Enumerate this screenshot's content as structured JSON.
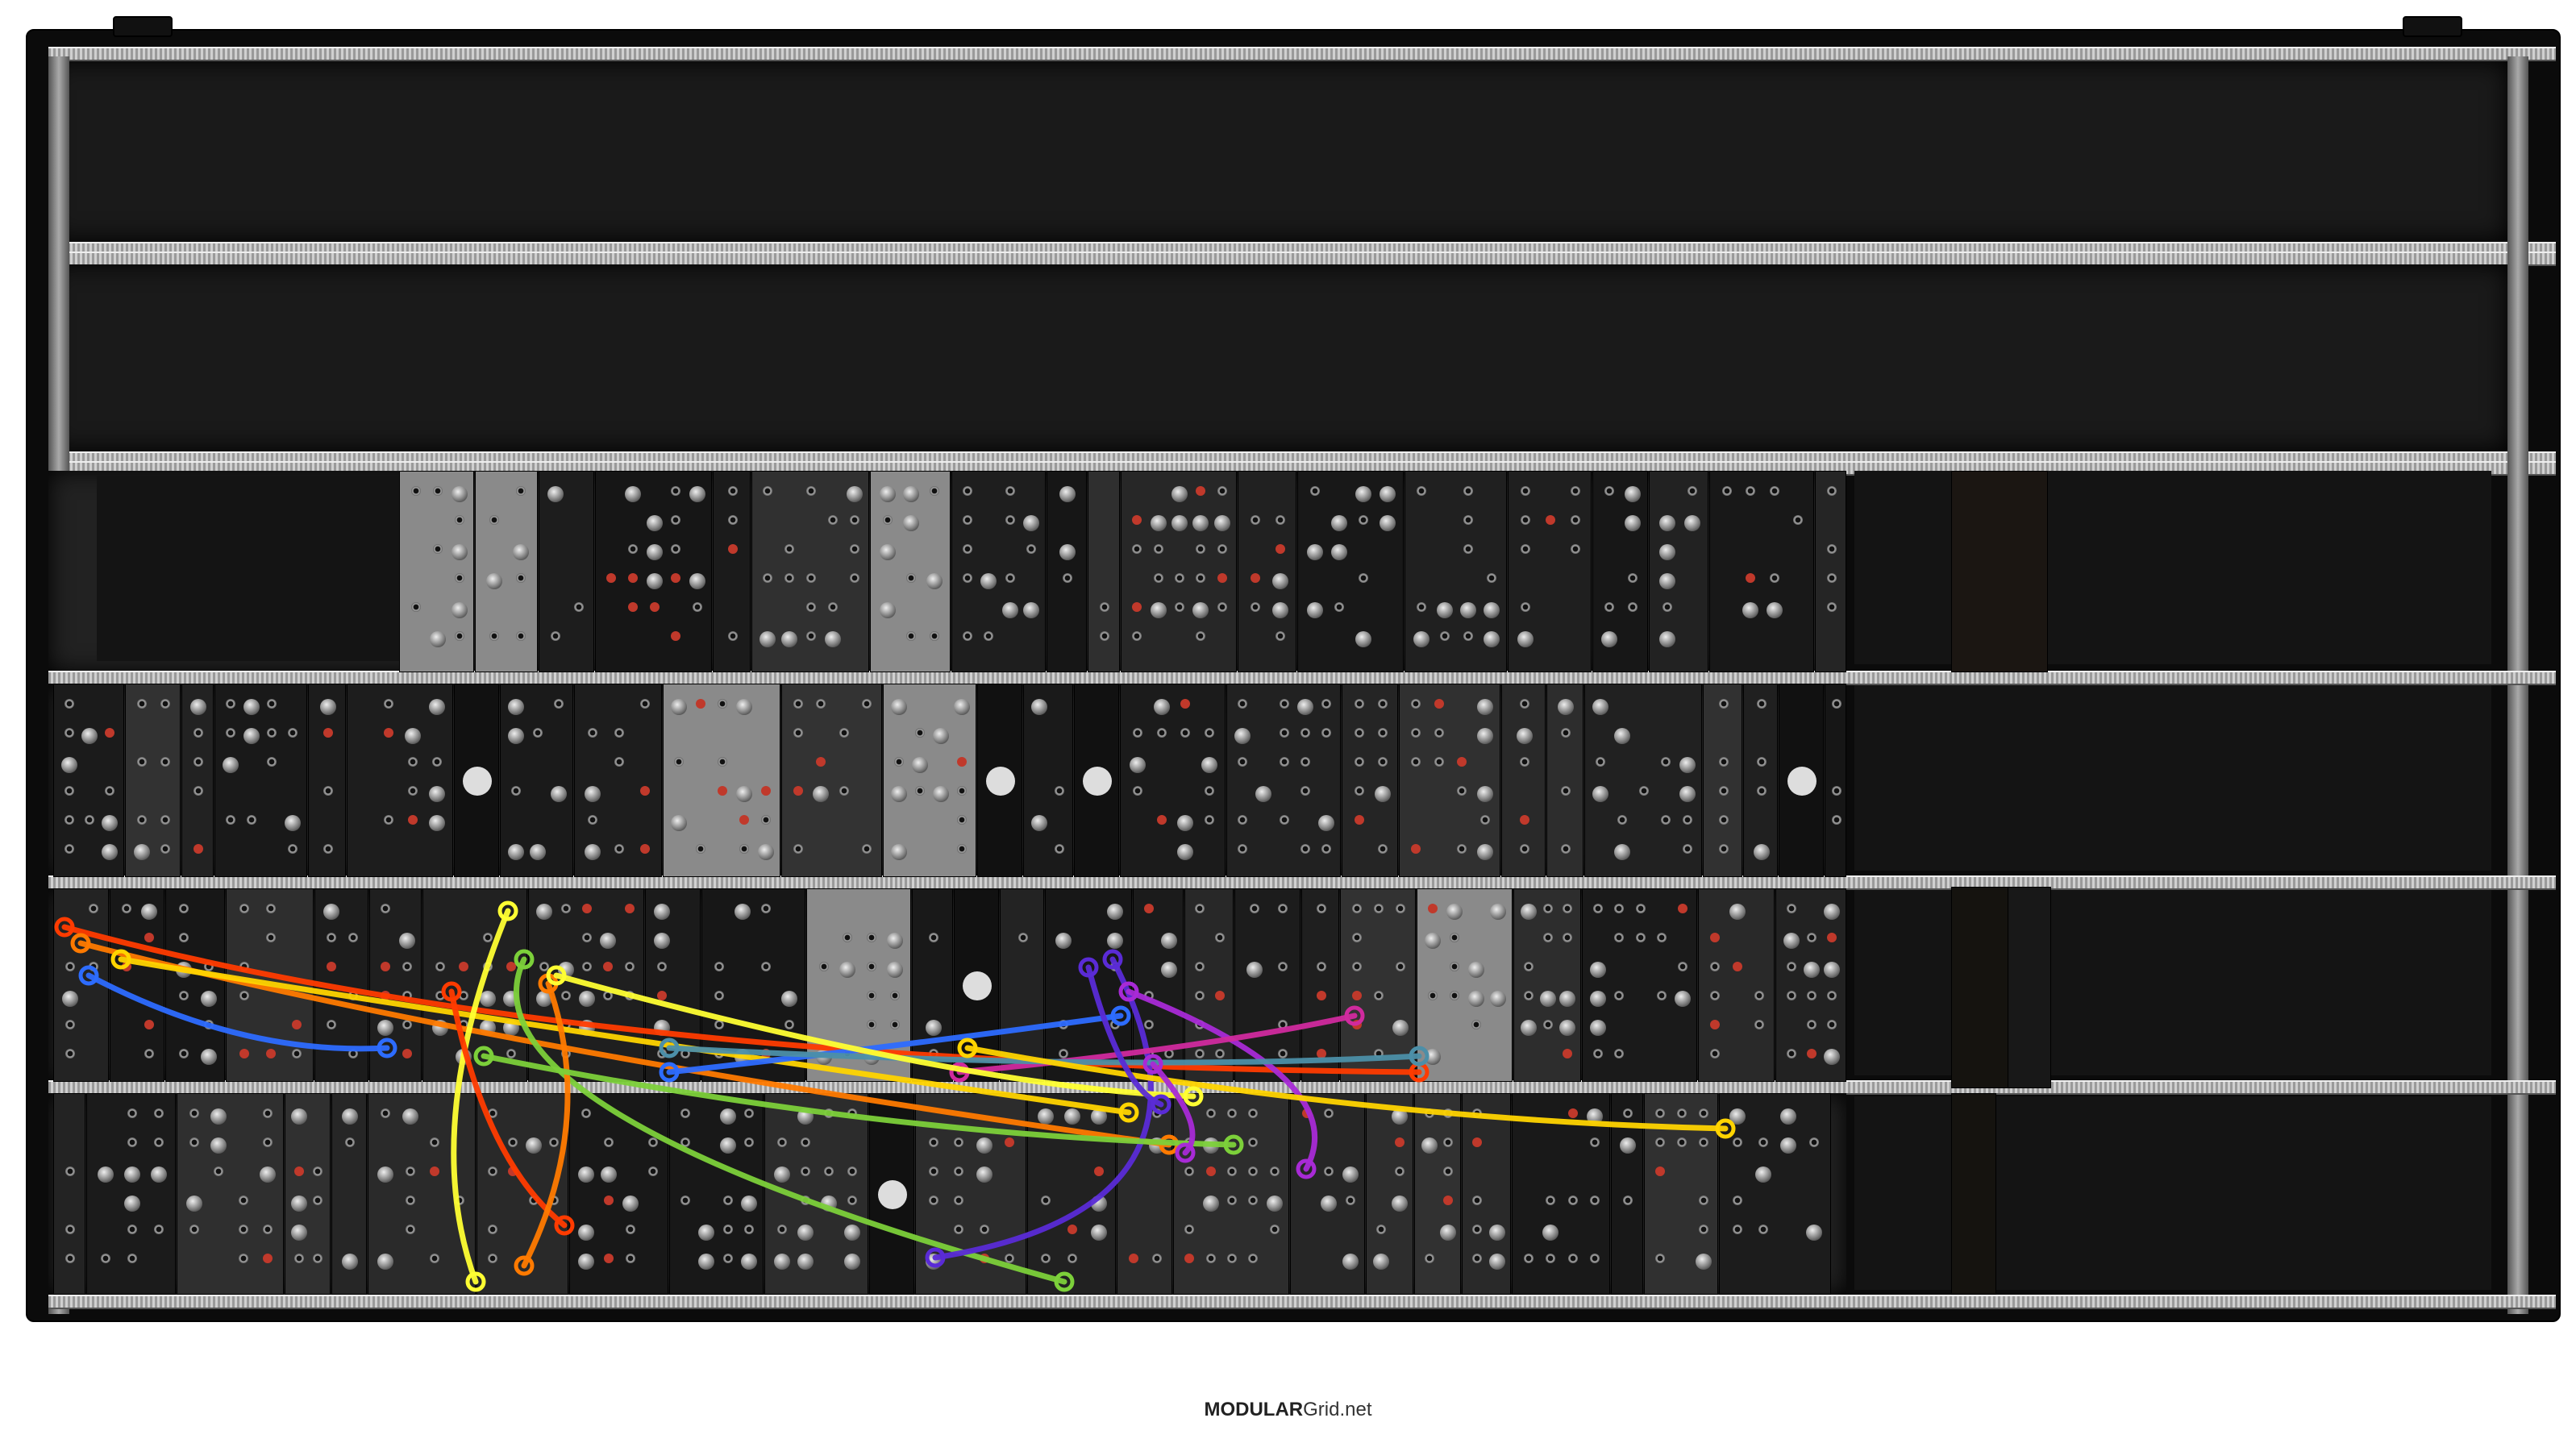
{
  "footer": {
    "brand_bold": "MODULAR",
    "brand_rest": "Grid.net"
  },
  "rack": {
    "rows": 6,
    "colors": {
      "case": "#0b0b0b",
      "rail": "#c0c0c0",
      "empty_row": "#1a1a1a"
    }
  },
  "modules": [
    {
      "row": 2,
      "style": "dark"
    },
    {
      "row": 2,
      "style": "dark"
    },
    {
      "row": 2,
      "style": "dark"
    },
    {
      "row": 3,
      "style": "dark"
    },
    {
      "row": 3,
      "style": "silver"
    },
    {
      "row": 3,
      "style": "dark"
    },
    {
      "row": 4,
      "style": "dark"
    },
    {
      "row": 4,
      "style": "dark"
    },
    {
      "row": 5,
      "style": "dark"
    }
  ],
  "cables": [
    {
      "color": "#ff3b00"
    },
    {
      "color": "#ff7a00"
    },
    {
      "color": "#ffd400"
    },
    {
      "color": "#ffff33"
    },
    {
      "color": "#7cd03a"
    },
    {
      "color": "#2d6cff"
    },
    {
      "color": "#5a2bd6"
    },
    {
      "color": "#a82ad6"
    },
    {
      "color": "#d02a9e"
    },
    {
      "color": "#4c8fa8"
    }
  ]
}
